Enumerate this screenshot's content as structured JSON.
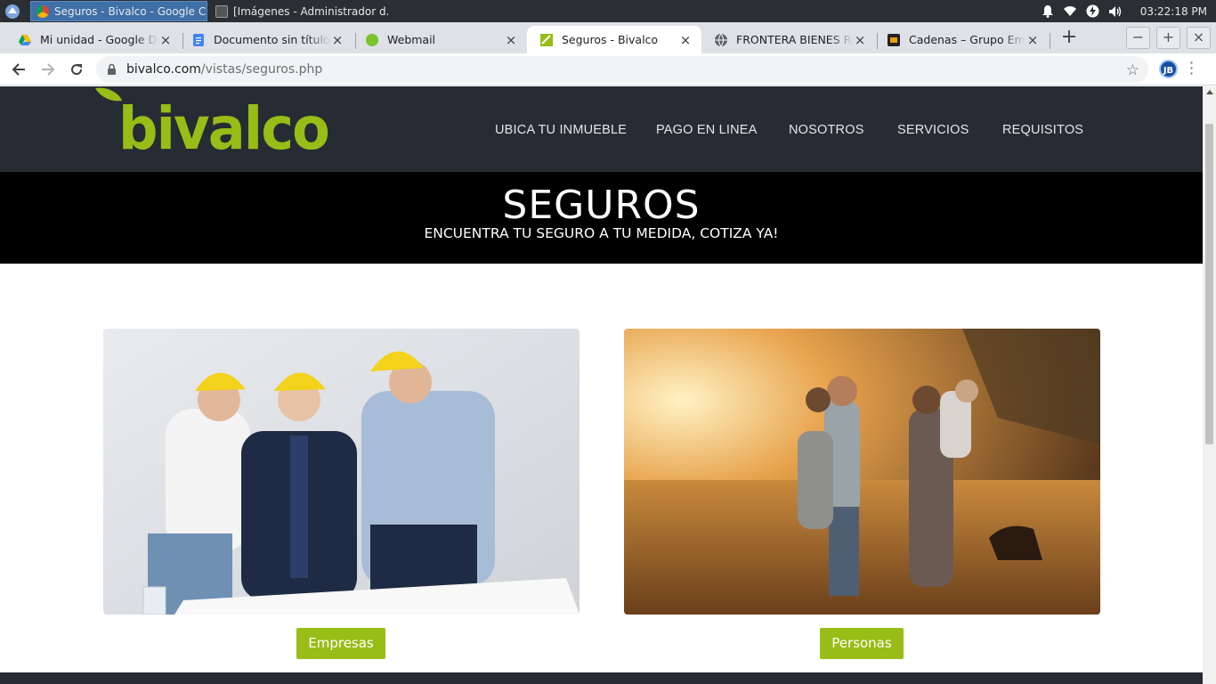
{
  "os": {
    "tasks": [
      {
        "label": "Seguros - Bivalco - Google C..."
      },
      {
        "label": "[Imágenes - Administrador d..."
      }
    ],
    "clock": "03:22:18 PM"
  },
  "browser": {
    "tabs": [
      {
        "title": "Mi unidad - Google Drive",
        "icon": "google-drive-icon"
      },
      {
        "title": "Documento sin título - Documentos",
        "icon": "google-docs-icon"
      },
      {
        "title": "Webmail",
        "icon": "webmail-icon"
      },
      {
        "title": "Seguros - Bivalco",
        "icon": "bivalco-icon"
      },
      {
        "title": "FRONTERA BIENES RAICES",
        "icon": "globe-icon"
      },
      {
        "title": "Cadenas – Grupo Empresarial",
        "icon": "cadenas-icon"
      }
    ],
    "tab_close": "×",
    "new_tab": "+",
    "window_buttons": [
      "−",
      "+",
      "×"
    ],
    "url_domain": "bivalco.com",
    "url_path": "/vistas/seguros.php",
    "profile_initials": "JB"
  },
  "site": {
    "logo_text": "bivalco",
    "brand_color": "#97bd16",
    "nav": [
      "UBICA TU INMUEBLE",
      "PAGO EN LINEA",
      "NOSOTROS",
      "SERVICIOS",
      "REQUISITOS"
    ],
    "hero_title": "SEGUROS",
    "hero_subtitle": "ENCUENTRA TU SEGURO A TU MEDIDA, COTIZA YA!",
    "cards": [
      {
        "button": "Empresas",
        "image": "construction-engineers-photo"
      },
      {
        "button": "Personas",
        "image": "family-field-sunset-photo"
      }
    ]
  }
}
